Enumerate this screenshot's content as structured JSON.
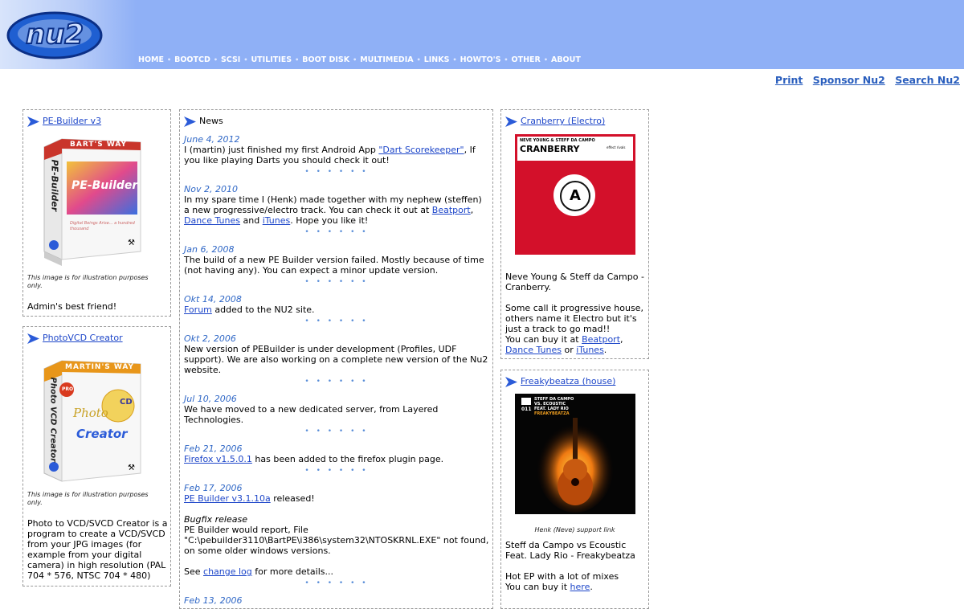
{
  "nav": [
    "HOME",
    "BOOTCD",
    "SCSI",
    "UTILITIES",
    "BOOT DISK",
    "MULTIMEDIA",
    "LINKS",
    "HOWTO'S",
    "OTHER",
    "ABOUT"
  ],
  "logo_text": "nu2",
  "tools": {
    "print": "Print",
    "sponsor": "Sponsor Nu2",
    "search": "Search Nu2"
  },
  "left": [
    {
      "title": "PE-Builder v3",
      "box_brand": "BART'S WAY",
      "box_side": "PE-Builder",
      "box_logo": "PE-Builder",
      "box_tagline": "Digital Beings Arise... a hundred thousand",
      "note": "This image is for illustration purposes only.",
      "desc": "Admin's best friend!"
    },
    {
      "title": "PhotoVCD Creator",
      "box_brand": "MARTIN'S WAY",
      "box_side": "Photo VCD Creator",
      "box_pro": "PRO",
      "box_photo": "Photo",
      "box_cd": "CD",
      "box_creator": "Creator",
      "note": "This image is for illustration purposes only.",
      "desc": "Photo to VCD/SVCD Creator is a program to create a VCD/SVCD from your JPG images (for example from your digital camera) in high resolution (PAL 704 * 576, NTSC 704 * 480)"
    }
  ],
  "news_title": "News",
  "news": [
    {
      "date": "June 4, 2012",
      "pre": "I (martin) just finished my first Android App ",
      "link": "\"Dart Scorekeeper\"",
      "post": ", If you like playing Darts you should check it out!"
    },
    {
      "date": "Nov 2, 2010",
      "pre": "In my spare time I (Henk) made together with my nephew (steffen) a new progressive/electro track. You can check it out at ",
      "link": "Beatport",
      "mid": ", ",
      "link2": "Dance Tunes",
      "mid2": " and ",
      "link3": "iTunes",
      "post": ". Hope you like it!"
    },
    {
      "date": "Jan 6, 2008",
      "pre": "The build of a new PE Builder version failed. Mostly because of time (not having any). You can expect a minor update version."
    },
    {
      "date": "Okt 14, 2008",
      "link": "Forum",
      "post": " added to the NU2 site."
    },
    {
      "date": "Okt 2, 2006",
      "pre": "New version of PEBuilder is under development (Profiles, UDF support). We are also working on a complete new version of the Nu2 website."
    },
    {
      "date": "Jul 10, 2006",
      "pre": "We have moved to a new dedicated server, from Layered Technologies."
    },
    {
      "date": "Feb 21, 2006",
      "link": "Firefox v1.5.0.1",
      "post": " has been added to the firefox plugin page."
    },
    {
      "date": "Feb 17, 2006",
      "link": "PE Builder v3.1.10a",
      "post": " released!",
      "bugfix": "Bugfix release",
      "bugtext": "PE Builder would report, File \"C:\\pebuilder3110\\BartPE\\i386\\system32\\NTOSKRNL.EXE\" not found, on some older windows versions.",
      "see_pre": "See ",
      "see_link": "change log",
      "see_post": " for more details..."
    },
    {
      "date": "Feb 13, 2006"
    }
  ],
  "dots": "• • • • • •",
  "right": [
    {
      "title": "Cranberry (Electro)",
      "cover_artists": "NEVE YOUNG & STEFF DA CAMPO",
      "cover_title": "CRANBERRY",
      "cover_label": "effect rivals",
      "cover_logo": "A",
      "p1": "Neve Young & Steff da Campo - Cranberry.",
      "p2": "Some call it progressive house, others name it Electro but it's just a track to go mad!!",
      "buy_pre": "You can buy it at ",
      "l1": "Beatport",
      ",": ",",
      "l2": "Dance Tunes",
      "or": " or ",
      "l3": "iTunes",
      "end": "."
    },
    {
      "title": "Freakybeatza (house)",
      "cover_num": "011",
      "cover_l1": "STEFF DA CAMPO",
      "cover_l2": "VS. ECOUSTIC",
      "cover_l3": "FEAT. LADY RIO",
      "cover_l4": "FREAKYBEATZA",
      "support": "Henk (Neve) support link",
      "p1": "Steff da Campo vs Ecoustic Feat. Lady Rio - Freakybeatza",
      "p2": "Hot EP with a lot of mixes",
      "buy_pre": "You can buy it ",
      "here": "here",
      "end": "."
    }
  ],
  "colors": {
    "header": "#8fb0f6",
    "link": "#1d46c9",
    "date": "#2f67c6",
    "cranberry": "#d3102a"
  }
}
